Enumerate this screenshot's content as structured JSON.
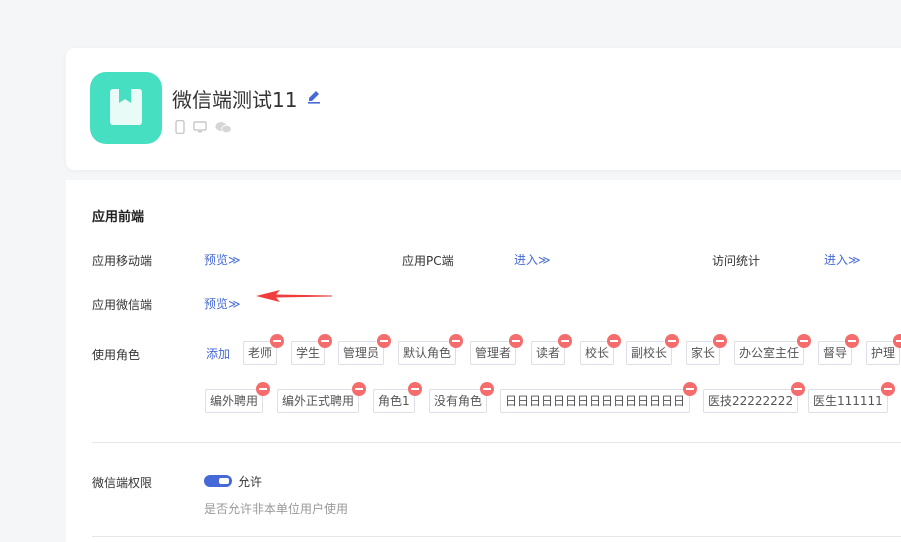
{
  "header": {
    "app_name": "微信端测试11",
    "colors": {
      "logo": "#47dfc2",
      "accent": "#4669d8"
    }
  },
  "front_end": {
    "title": "应用前端",
    "mobile_label": "应用移动端",
    "mobile_link": "预览≫",
    "pc_label": "应用PC端",
    "pc_link": "进入≫",
    "stats_label": "访问统计",
    "stats_link": "进入≫",
    "wechat_label": "应用微信端",
    "wechat_link": "预览≫"
  },
  "roles": {
    "label": "使用角色",
    "add": "添加",
    "row1": [
      "老师",
      "学生",
      "管理员",
      "默认角色",
      "管理者",
      "读者",
      "校长",
      "副校长",
      "家长",
      "办公室主任",
      "督导",
      "护理"
    ],
    "row2": [
      "编外聘用",
      "编外正式聘用",
      "角色1",
      "没有角色",
      "日日日日日日日日日日日日日日日",
      "医技22222222",
      "医生111111"
    ]
  },
  "permission": {
    "label": "微信端权限",
    "toggle_label": "允许",
    "hint": "是否允许非本单位用户使用"
  }
}
